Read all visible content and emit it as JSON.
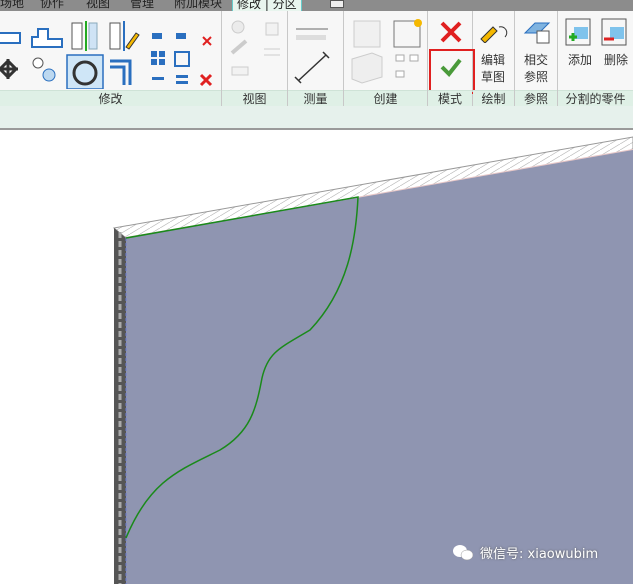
{
  "tabs": [
    "场地",
    "协作",
    "视图",
    "管理",
    "附加模块",
    "修改 | 分区"
  ],
  "panels": {
    "modify": "修改",
    "view": "视图",
    "measure": "测量",
    "create": "创建",
    "mode": "模式",
    "draw": "绘制",
    "reference": "参照",
    "parts": "分割的零件"
  },
  "buttons": {
    "edit_sketch": [
      "编辑",
      "草图"
    ],
    "intersect_ref": [
      "相交",
      "参照"
    ],
    "add": "添加",
    "remove": "删除"
  },
  "watermark": "微信号: xiaowubim",
  "colors": {
    "face": "#8f95b1",
    "sketch": "#1a8a1a",
    "highlight": "#e02020"
  }
}
